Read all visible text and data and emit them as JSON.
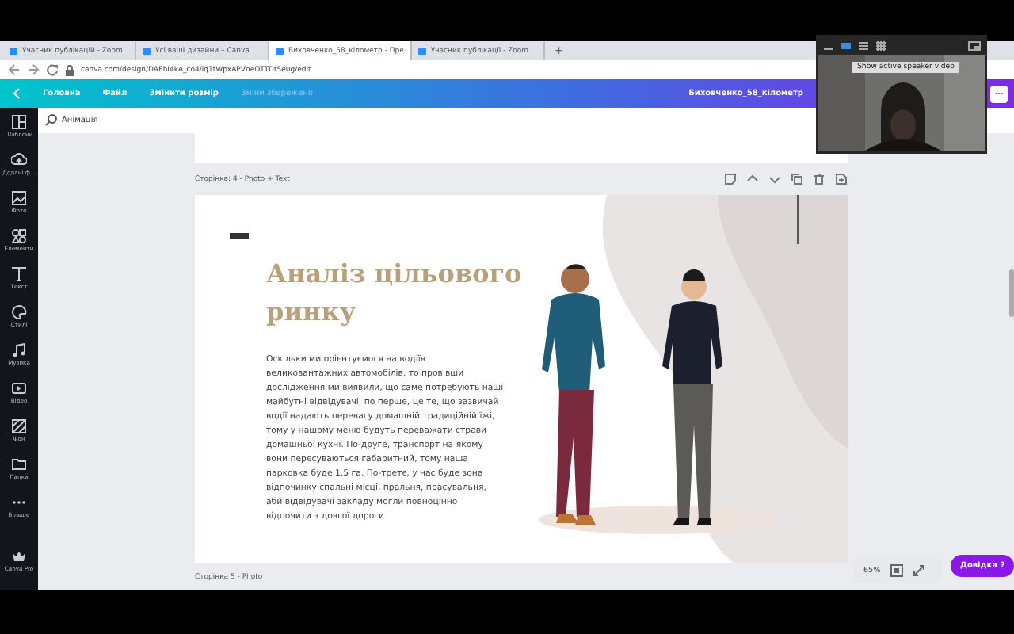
{
  "browser": {
    "tabs": [
      {
        "title": "Учасник публікацій - Zoom",
        "selected": false
      },
      {
        "title": "Усі ваші дизайни – Canva",
        "selected": false
      },
      {
        "title": "Биховченко_58_кілометр - Пре",
        "selected": true
      },
      {
        "title": "Учасник публікації - Zoom",
        "selected": false
      }
    ],
    "new_tab": "+",
    "address": "canva.com/design/DAEhI4kA_co4/lq1tWpxAPVneOTTDt5eug/edit"
  },
  "editor_bar": {
    "home": "Головна",
    "file": "Файл",
    "resize": "Змінити розмір",
    "save_status": "Зміни збережено",
    "design_title": "Биховченко_58_кілометр",
    "more": "···"
  },
  "sidebar": {
    "items": [
      {
        "label": "Шаблони"
      },
      {
        "label": "Додані ф..."
      },
      {
        "label": "Фото"
      },
      {
        "label": "Елементи"
      },
      {
        "label": "Текст"
      },
      {
        "label": "Стилі"
      },
      {
        "label": "Музика"
      },
      {
        "label": "Відео"
      },
      {
        "label": "Фон"
      },
      {
        "label": "Папки"
      },
      {
        "label": "Більше"
      }
    ],
    "pro": "Canva Pro"
  },
  "toolbar": {
    "animate": "Анімація"
  },
  "pages": [
    {
      "label": "Сторінка: 4 - Photo + Text",
      "title": "Аналіз цільового ринку",
      "body": "Оскільки ми орієнтуємося на водіїв великовантажних автомобілів, то провівши дослідження ми виявили, що саме потребують наші майбутні відвідувачі, по перше, це те, що зазвичай водії надають перевагу домашній традиційній їжі, тому у нашому меню будуть переважати страви домашньої кухні. По-друге, транспорт на якому вони пересуваються габаритний, тому наша парковка буде 1,5 га. По-третє, у нас буде зона відпочинку спальні місці, пральня, прасувальня, аби відвідувачі закладу могли повноцінно відпочити з довгої дороги"
    },
    {
      "label": "Сторінка 5 - Photo"
    }
  ],
  "zoom": {
    "level": "65%",
    "help": "Довідка ?"
  },
  "video": {
    "tooltip": "Show active speaker video"
  }
}
